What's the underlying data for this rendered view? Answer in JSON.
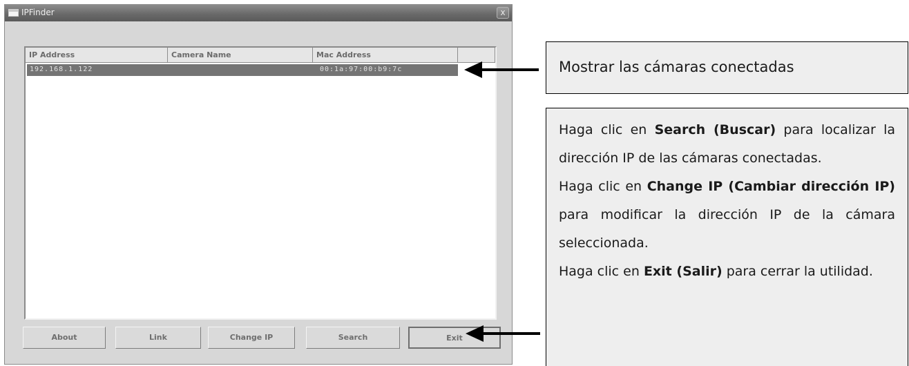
{
  "window": {
    "title": "IPFinder",
    "close_label": "x"
  },
  "list": {
    "columns": [
      "IP Address",
      "Camera Name",
      "Mac Address",
      ""
    ],
    "rows": [
      {
        "ip": "192.168.1.122",
        "camera_name": "",
        "mac": "00:1a:97:00:b9:7c"
      }
    ]
  },
  "buttons": {
    "about": "About",
    "link": "Link",
    "change_ip": "Change IP",
    "search": "Search",
    "exit": "Exit"
  },
  "callout_top": {
    "text": "Mostrar las cámaras conectadas"
  },
  "callout_bottom": {
    "p1_pre": "Haga clic en ",
    "p1_bold": "Search (Buscar)",
    "p1_post": " para localizar la dirección IP de las cámaras conectadas.",
    "p2_pre": "Haga clic en ",
    "p2_bold": "Change IP (Cambiar dirección IP)",
    "p2_post": " para modificar la dirección IP de la cámara seleccionada.",
    "p3_pre": "Haga clic en ",
    "p3_bold": "Exit (Salir)",
    "p3_post": " para cerrar la utilidad."
  }
}
